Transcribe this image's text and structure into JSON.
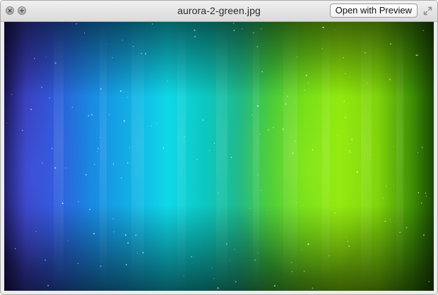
{
  "window": {
    "title": "aurora-2-green.jpg"
  },
  "toolbar": {
    "open_label": "Open with Preview"
  },
  "icons": {
    "close": "close-icon",
    "fullscreen": "fullscreen-icon",
    "resize": "resize-icon"
  },
  "image": {
    "description_colors": [
      "#2f55d6",
      "#0fd8e8",
      "#8ee60b"
    ]
  }
}
